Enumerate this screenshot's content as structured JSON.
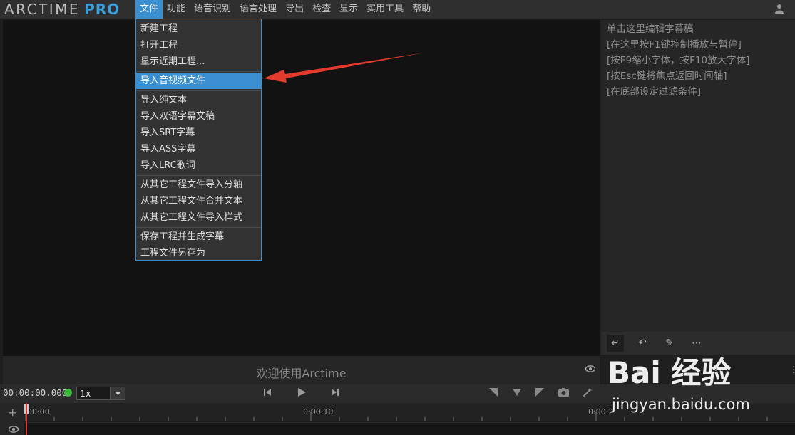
{
  "app": {
    "logo_text": "ARCTIME",
    "logo_accent": "PRO"
  },
  "menu": [
    {
      "label": "文件",
      "active": true
    },
    {
      "label": "功能"
    },
    {
      "label": "语音识别"
    },
    {
      "label": "语言处理"
    },
    {
      "label": "导出"
    },
    {
      "label": "检查"
    },
    {
      "label": "显示"
    },
    {
      "label": "实用工具"
    },
    {
      "label": "帮助"
    }
  ],
  "file_menu": {
    "items": [
      "新建工程",
      "打开工程",
      "显示近期工程...",
      "导入音视频文件",
      "导入纯文本",
      "导入双语字幕文稿",
      "导入SRT字幕",
      "导入ASS字幕",
      "导入LRC歌词",
      "从其它工程文件导入分轴",
      "从其它工程文件合并文本",
      "从其它工程文件导入样式",
      "保存工程并生成字幕",
      "工程文件另存为"
    ],
    "selected_index": 3
  },
  "editor": {
    "hints": [
      "单击这里编辑字幕稿",
      "[在这里按F1键控制播放与暂停]",
      "[按F9缩小字体，按F10放大字体]",
      "[按Esc键将焦点返回时间轴]",
      "[在底部设定过滤条件]"
    ]
  },
  "video": {
    "welcome": "欢迎使用Arctime"
  },
  "transport": {
    "timecode": "00:00:00.000",
    "speed": "1x"
  },
  "timeline": {
    "ticks": [
      "00:00",
      "0:00:10",
      "0:00:2"
    ]
  },
  "watermark": {
    "text": "Bai 经验",
    "url": "jingyan.baidu.com"
  },
  "colors": {
    "accent": "#3a8fd0",
    "arrow": "#e23b2e",
    "status_dot": "#3cb83c"
  }
}
